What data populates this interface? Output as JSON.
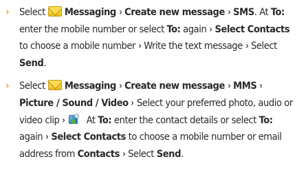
{
  "steps": [
    {
      "select": "Select",
      "messaging": "Messaging",
      "create_new_message": "Create new message",
      "sms": "SMS",
      "text_a": ". At ",
      "to": "To:",
      "text_b": " enter the mobile number or select ",
      "to_again": "To:",
      "text_c": " again ",
      "select_contacts": "Select Contacts",
      "text_d": " to choose a mobile number ",
      "text_e": " Write the text message ",
      "select_send_prefix": "Select ",
      "send": "Send",
      "period": "."
    },
    {
      "select": "Select",
      "messaging": "Messaging",
      "create_new_message": "Create new message",
      "mms": "MMS",
      "picture_sound_video": "Picture / Sound / Video",
      "text_a": " Select your preferred photo, audio or video clip ",
      "text_b": " At ",
      "to": "To:",
      "text_c": " enter the contact details or select ",
      "to_again": "To:",
      "text_d": " again ",
      "select_contacts": "Select Contacts",
      "text_e": " to choose a mobile number or email address from ",
      "contacts": "Contacts",
      "select_send_prefix": "Select ",
      "send": "Send",
      "period": "."
    }
  ],
  "glyphs": {
    "bullet": "›",
    "arrow": "›"
  },
  "icons": {
    "messaging": "envelope-icon",
    "media": "media-gallery-icon"
  },
  "colors": {
    "bullet": "#e2a422",
    "text": "#2a2a2a"
  }
}
